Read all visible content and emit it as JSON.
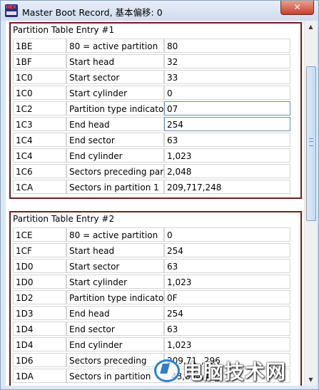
{
  "window": {
    "title": "Master Boot Record, 基本偏移: 0",
    "app_icon_text": "HEX",
    "close_label": "✕"
  },
  "groups": [
    {
      "title": "Partition Table Entry #1",
      "rows": [
        {
          "offset": "1BE",
          "desc": "80 = active partition",
          "value": "80"
        },
        {
          "offset": "1BF",
          "desc": "Start head",
          "value": "32"
        },
        {
          "offset": "1C0",
          "desc": "Start sector",
          "value": "33"
        },
        {
          "offset": "1C0",
          "desc": "Start cylinder",
          "value": "0"
        },
        {
          "offset": "1C2",
          "desc": "Partition type indicator",
          "value": "07"
        },
        {
          "offset": "1C3",
          "desc": "End head",
          "value": "254"
        },
        {
          "offset": "1C4",
          "desc": "End sector",
          "value": "63"
        },
        {
          "offset": "1C4",
          "desc": "End cylinder",
          "value": "1,023"
        },
        {
          "offset": "1C6",
          "desc": "Sectors preceding partition",
          "value": "2,048"
        },
        {
          "offset": "1CA",
          "desc": "Sectors in partition 1",
          "value": "209,717,248"
        }
      ]
    },
    {
      "title": "Partition Table Entry #2",
      "rows": [
        {
          "offset": "1CE",
          "desc": "80 = active partition",
          "value": "0"
        },
        {
          "offset": "1CF",
          "desc": "Start head",
          "value": "254"
        },
        {
          "offset": "1D0",
          "desc": "Start sector",
          "value": "63"
        },
        {
          "offset": "1D0",
          "desc": "Start cylinder",
          "value": "1,023"
        },
        {
          "offset": "1D2",
          "desc": "Partition type indicator",
          "value": "0F"
        },
        {
          "offset": "1D3",
          "desc": "End head",
          "value": "254"
        },
        {
          "offset": "1D4",
          "desc": "End sector",
          "value": "63"
        },
        {
          "offset": "1D4",
          "desc": "End cylinder",
          "value": "1,023"
        },
        {
          "offset": "1D6",
          "desc": "Sectors preceding",
          "value": "209,71_,296"
        },
        {
          "offset": "1DA",
          "desc": "Sectors in partition",
          "value": "_43,804,41_"
        }
      ]
    }
  ],
  "watermark": {
    "text": "电脑技术网",
    "icon": "monitor-logo-icon"
  },
  "colors": {
    "group_border": "#7a1a1a",
    "highlight_border": "#6b8fc0"
  }
}
